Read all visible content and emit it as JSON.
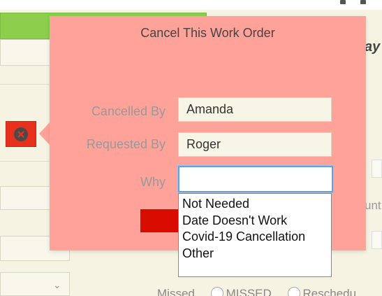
{
  "popover": {
    "title": "Cancel This Work Order",
    "fields": {
      "cancelled_by": {
        "label": "Cancelled By",
        "value": "Amanda"
      },
      "requested_by": {
        "label": "Requested By",
        "value": "Roger"
      },
      "why": {
        "label": "Why",
        "value": ""
      }
    },
    "why_options": [
      "Not Needed",
      "Date Doesn't Work",
      "Covid-19 Cancellation",
      "Other"
    ]
  },
  "background": {
    "partial_heading": "ay",
    "partial_label_right": "unt",
    "radio_row": {
      "label": "Missed",
      "options": [
        "MISSED",
        "Reschedu"
      ]
    }
  },
  "colors": {
    "popover_bg": "#ffa29a",
    "submit_red": "#d80c00",
    "cancel_x_red": "#e8311c",
    "green_bar": "#8ccf4d",
    "focus_blue": "#6aa0d8"
  },
  "icons": {
    "cancel_x": "close-circle-icon",
    "select_chevron": "chevron-down-icon"
  }
}
